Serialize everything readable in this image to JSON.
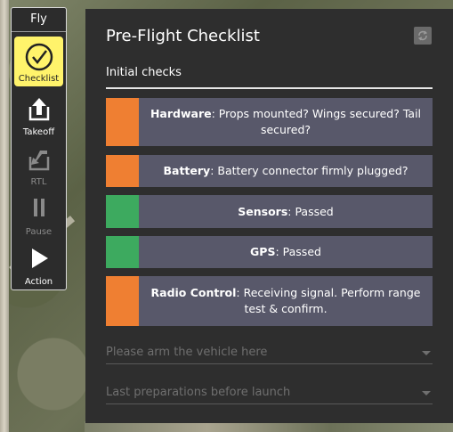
{
  "toolbar": {
    "title": "Fly",
    "items": [
      {
        "label": "Checklist",
        "icon": "checklist-icon",
        "state": "active"
      },
      {
        "label": "Takeoff",
        "icon": "takeoff-icon",
        "state": "enabled"
      },
      {
        "label": "RTL",
        "icon": "rtl-icon",
        "state": "disabled"
      },
      {
        "label": "Pause",
        "icon": "pause-icon",
        "state": "disabled"
      },
      {
        "label": "Action",
        "icon": "action-icon",
        "state": "enabled"
      }
    ]
  },
  "checklist": {
    "title": "Pre-Flight Checklist",
    "reset_icon": "reset-icon",
    "section": "Initial checks",
    "items": [
      {
        "name": "Hardware",
        "message": ": Props mounted? Wings secured? Tail secured?",
        "status": "pending"
      },
      {
        "name": "Battery",
        "message": ": Battery connector firmly plugged?",
        "status": "pending"
      },
      {
        "name": "Sensors",
        "message": ": Passed",
        "status": "passed"
      },
      {
        "name": "GPS",
        "message": ": Passed",
        "status": "passed"
      },
      {
        "name": "Radio Control",
        "message": ": Receiving signal. Perform range test & confirm.",
        "status": "pending"
      }
    ],
    "dropdowns": [
      {
        "label": "Please arm the vehicle here"
      },
      {
        "label": "Last preparations before launch"
      }
    ]
  },
  "colors": {
    "pending": "#ef7f32",
    "passed": "#3daa5f",
    "active_tool": "#fff36b"
  }
}
